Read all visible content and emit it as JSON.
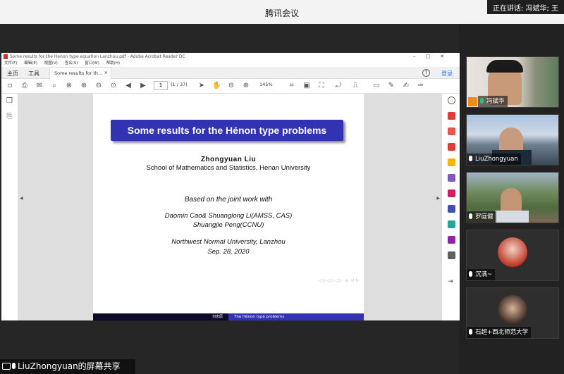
{
  "app": {
    "title": "腾讯会议",
    "speaking": "正在讲话: 冯斌华; 王"
  },
  "acrobat": {
    "window_title": "Some results for the H́enon type equation Lanzhou.pdf - Adobe Acrobat Reader DC",
    "menu": [
      "文件(F)",
      "编辑(E)",
      "视图(V)",
      "签名(S)",
      "窗口(W)",
      "帮助(H)"
    ],
    "tabs": {
      "home": "主页",
      "tools": "工具",
      "doc": "Some results for th...",
      "login": "登录"
    },
    "page_current": "1",
    "page_total": "(1 / 37)",
    "zoom": "145%"
  },
  "slide": {
    "title": "Some results for the Hénon type problems",
    "author": "Zhongyuan Liu",
    "affiliation": "School of Mathematics and Statistics, Henan University",
    "based_on": "Based on the joint work with",
    "coauthors_1": "Daomin Cao& Shuanglong Li(AMSS, CAS)",
    "coauthors_2": "Shuangjie Peng(CCNU)",
    "venue": "Northwest Normal University, Lanzhou",
    "date": "Sep. 28, 2020",
    "footer_left": "刘忠原",
    "footer_right": "The Hénon type problems"
  },
  "sharer": {
    "label": "LiuZhongyuan的屏幕共享"
  },
  "participants": [
    {
      "name": "冯斌华",
      "host": true,
      "mic_on": true
    },
    {
      "name": "LiuZhongyuan",
      "host": false,
      "mic_on": false
    },
    {
      "name": "罗庭健",
      "host": false,
      "mic_on": false
    },
    {
      "name": "沉满~",
      "host": false,
      "mic_on": false
    },
    {
      "name": "石超+西北师范大学",
      "host": false,
      "mic_on": false
    }
  ],
  "colors": {
    "slide_blue": "#3233b2",
    "footer_dark": "#0c0c2a",
    "mic_active": "#29c46a",
    "host_badge": "#f08c1f"
  }
}
